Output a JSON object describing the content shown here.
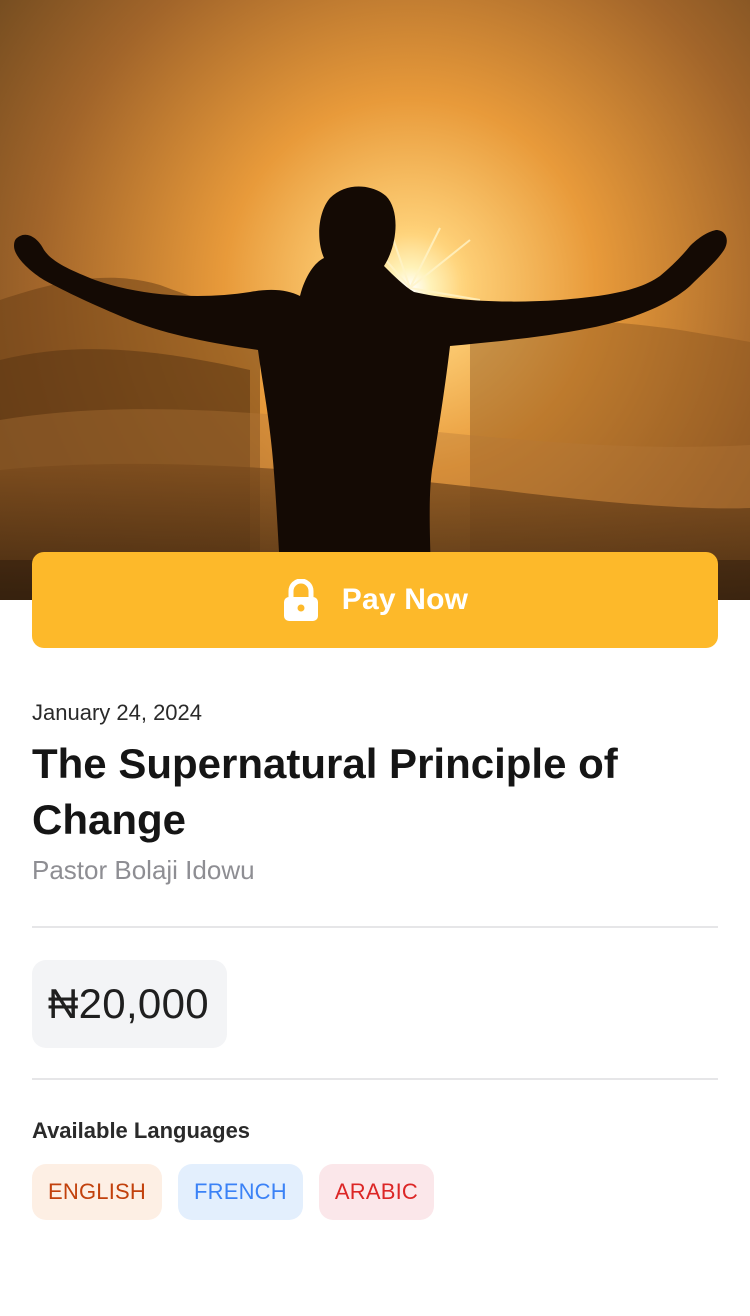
{
  "hero": {
    "image_alt": "Silhouette of a man with outstretched arms against a golden sunrise",
    "icon": "sunrise-hero-image"
  },
  "pay": {
    "label": "Pay Now",
    "icon": "lock-icon",
    "color": "#fdb92a"
  },
  "sermon": {
    "date": "January 24, 2024",
    "title": "The Supernatural Principle of Change",
    "speaker": "Pastor Bolaji Idowu"
  },
  "price": {
    "value": "₦20,000"
  },
  "languages": {
    "heading": "Available Languages",
    "items": [
      {
        "label": "ENGLISH",
        "color": "#c2410c",
        "background": "#fdefe4"
      },
      {
        "label": "FRENCH",
        "color": "#3b82f6",
        "background": "#e3effd"
      },
      {
        "label": "ARABIC",
        "color": "#dc2626",
        "background": "#fbe7ea"
      }
    ]
  }
}
